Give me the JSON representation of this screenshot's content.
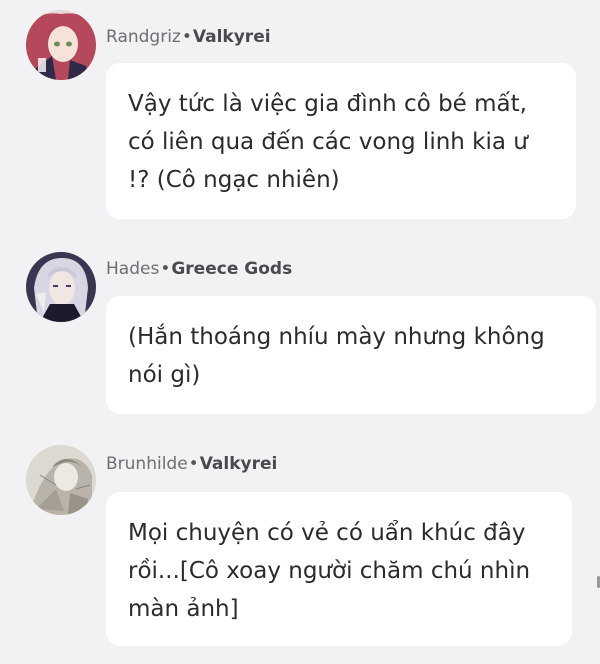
{
  "messages": [
    {
      "author_name": "Randgriz",
      "separator": "•",
      "author_group": "Valkyrei",
      "avatar_icon": "anime-girl-red-hair-avatar",
      "text": "Vậy tức là việc gia đình cô bé mất, có liên qua đến các vong linh kia ư !? (Cô ngạc nhiên)"
    },
    {
      "author_name": "Hades",
      "separator": "•",
      "author_group": "Greece Gods",
      "avatar_icon": "anime-man-white-hair-avatar",
      "text": "(Hắn thoáng nhíu mày nhưng không nói gì)"
    },
    {
      "author_name": "Brunhilde",
      "separator": "•",
      "author_group": "Valkyrei",
      "avatar_icon": "sketch-figure-avatar",
      "text": "Mọi chuyện có vẻ có uẩn khúc đây rồi...[Cô xoay người chăm chú nhìn màn ảnh]"
    }
  ],
  "colors": {
    "background": "#f2f2f4",
    "bubble": "#ffffff",
    "text": "#2b2b2f",
    "author": "#6f6f73"
  }
}
